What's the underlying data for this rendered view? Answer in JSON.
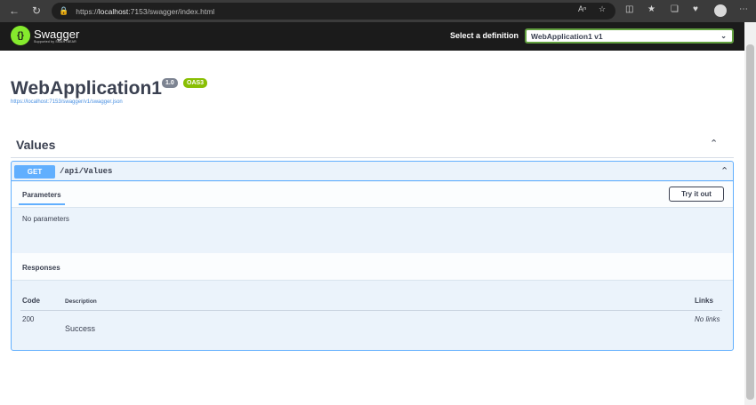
{
  "browser": {
    "url_prefix": "https://",
    "url_host": "localhost",
    "url_rest": ":7153/swagger/index.html"
  },
  "topbar": {
    "logo_title": "Swagger",
    "logo_subtitle": "Supported by SMARTBEAR",
    "definition_label": "Select a definition",
    "definition_value": "WebApplication1 v1"
  },
  "info": {
    "title": "WebApplication1",
    "version": "1.0",
    "oas": "OAS3",
    "spec_url": "https://localhost:7153/swagger/v1/swagger.json"
  },
  "tag": {
    "name": "Values"
  },
  "operation": {
    "method": "GET",
    "path": "/api/Values",
    "parameters_tab": "Parameters",
    "try_button": "Try it out",
    "no_parameters": "No parameters",
    "responses_title": "Responses",
    "columns": {
      "code": "Code",
      "description": "Description",
      "links": "Links"
    },
    "responses": [
      {
        "code": "200",
        "description": "Success",
        "links": "No links"
      }
    ]
  },
  "colors": {
    "get_blue": "#61affe",
    "swagger_green": "#85ea2d",
    "oas_green": "#89bf04",
    "topbar_bg": "#1b1b1b"
  }
}
